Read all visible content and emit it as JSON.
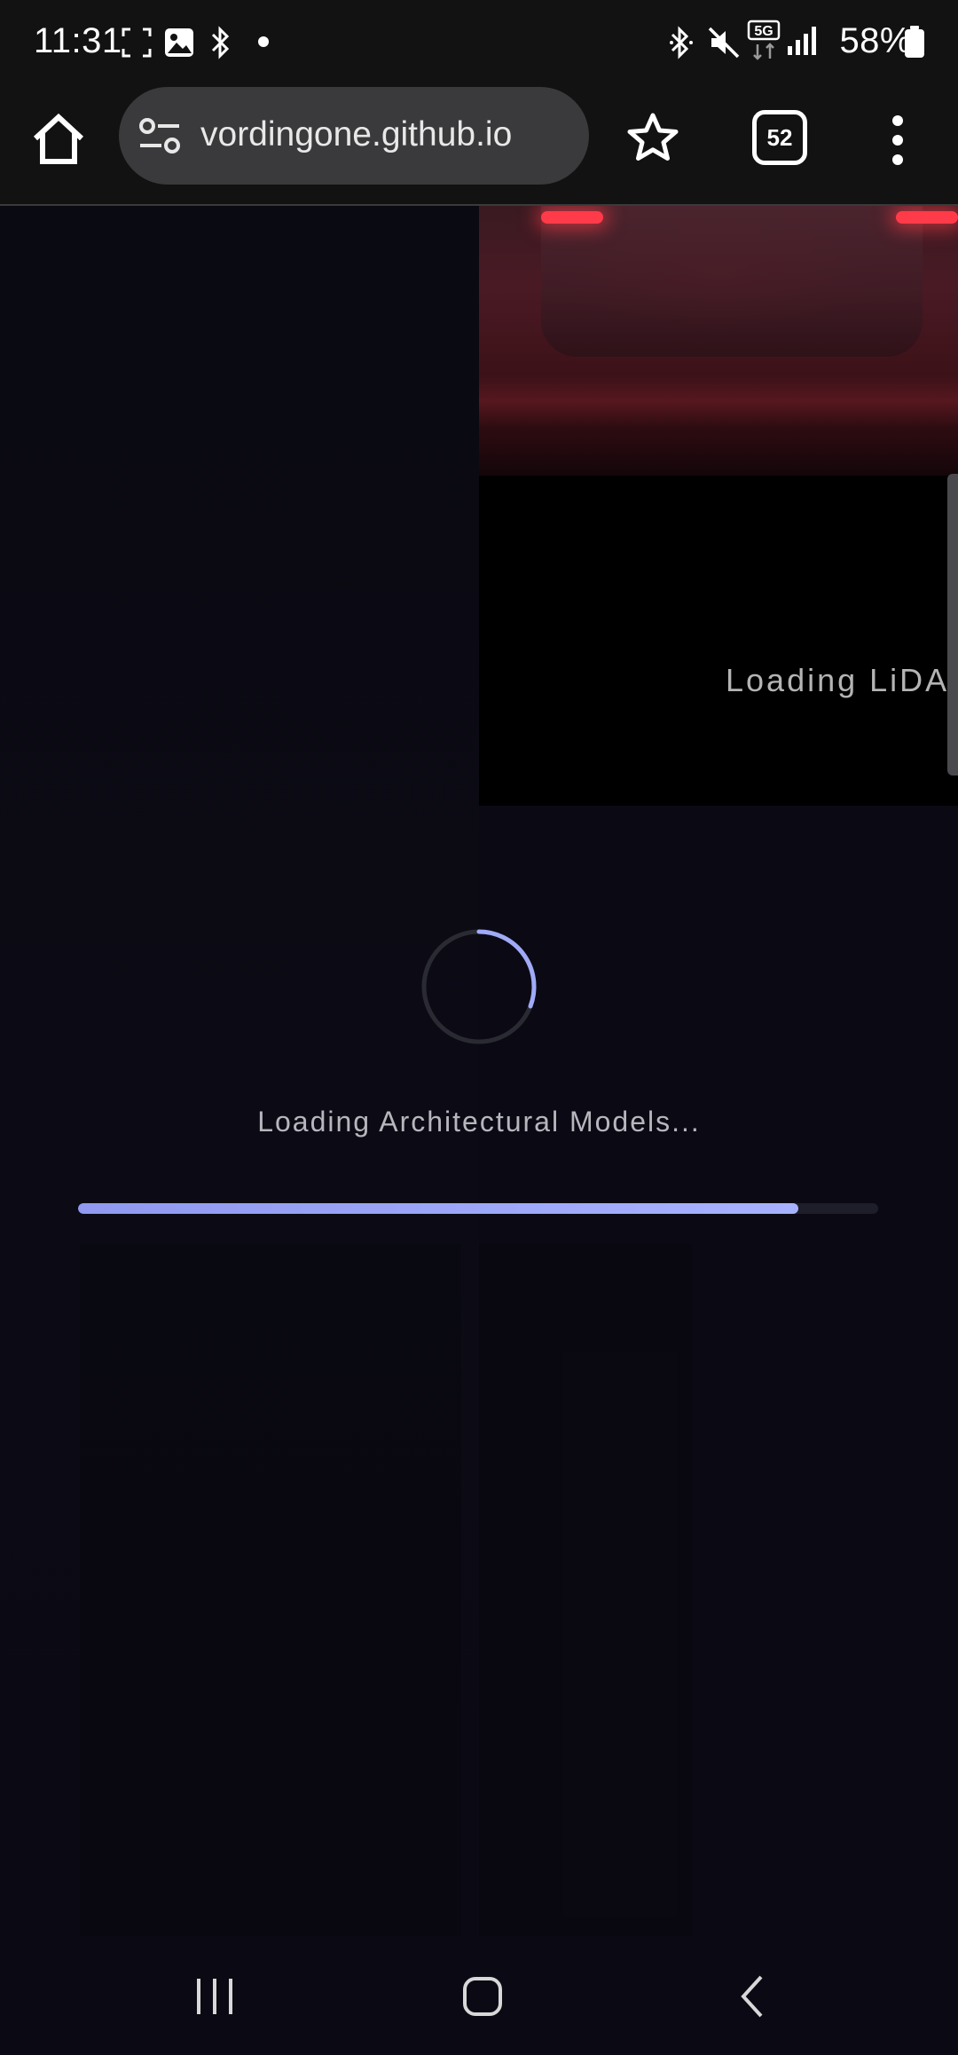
{
  "status_bar": {
    "time": "11:31",
    "battery_percent": "58%",
    "network_label": "5G",
    "left_icons": [
      "screenshot-icon",
      "gallery-icon",
      "bluetooth-icon",
      "notification-dot-icon"
    ],
    "right_icons": [
      "bluetooth-icon",
      "mute-icon",
      "network-5g-icon",
      "signal-icon",
      "battery-icon"
    ]
  },
  "browser": {
    "url": "vordingone.github.io",
    "tab_count": "52",
    "icons": [
      "home-icon",
      "site-settings-icon",
      "star-icon",
      "tabs-icon",
      "more-vert-icon"
    ]
  },
  "page": {
    "lidar_status": "Loading LiDA",
    "models_status": "Loading Architectural Models...",
    "progress": 0.9,
    "accent_color": "#a0aaf8"
  },
  "nav_bar": {
    "icons": [
      "recents-icon",
      "home-icon",
      "back-icon"
    ]
  }
}
